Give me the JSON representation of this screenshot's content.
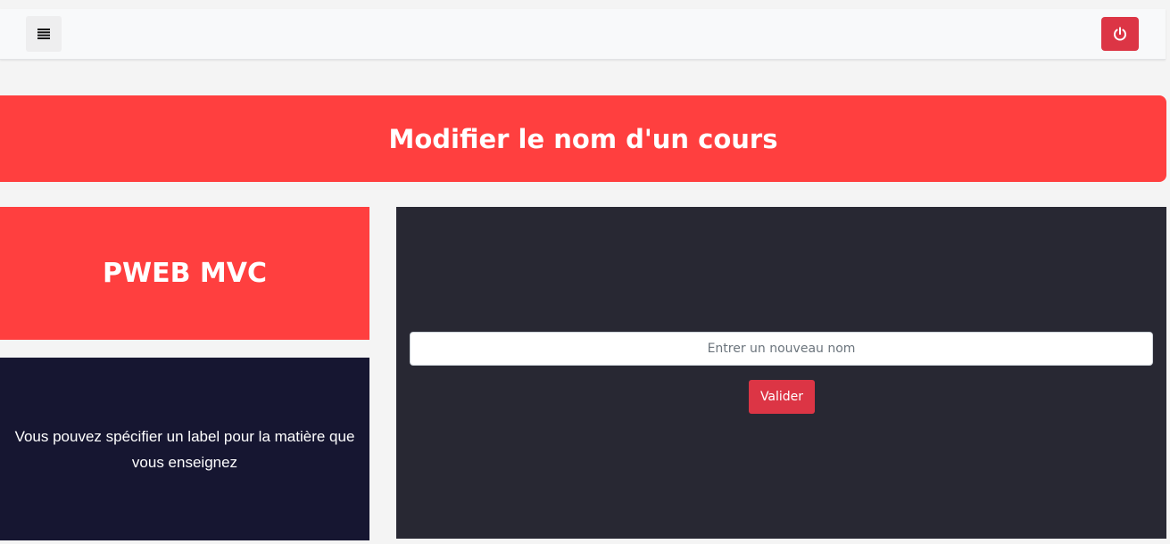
{
  "navbar": {
    "menu_icon": "hamburger-menu-icon",
    "logout_icon": "power-icon",
    "accent_color": "#dc3545",
    "background_color": "#f8f9fa"
  },
  "banner": {
    "title": "Modifier le nom d'un cours",
    "background_color": "#ff3f3f"
  },
  "course": {
    "name": "PWEB MVC",
    "description": "Vous pouvez spécifier un label pour la matière que vous enseignez"
  },
  "form": {
    "name_placeholder": "Entrer un nouveau nom",
    "name_value": "",
    "submit_label": "Valider",
    "panel_color": "#282833"
  }
}
